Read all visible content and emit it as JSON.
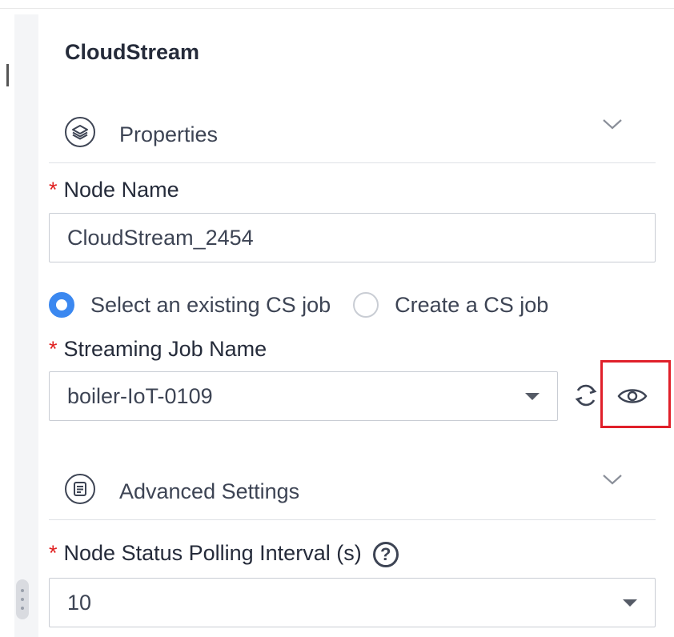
{
  "panel": {
    "title": "CloudStream"
  },
  "sections": {
    "properties": {
      "label": "Properties",
      "icon": "layers-icon"
    },
    "advanced": {
      "label": "Advanced Settings",
      "icon": "document-icon"
    }
  },
  "fields": {
    "required_mark": "*",
    "node_name": {
      "label": "Node Name",
      "value": "CloudStream_2454"
    },
    "job_source": {
      "options": [
        {
          "label": "Select an existing CS job",
          "checked": true
        },
        {
          "label": "Create a CS job",
          "checked": false
        }
      ]
    },
    "streaming_job": {
      "label": "Streaming Job Name",
      "value": "boiler-IoT-0109"
    },
    "polling_interval": {
      "label": "Node Status Polling Interval (s)",
      "value": "10",
      "help_glyph": "?"
    }
  },
  "colors": {
    "accent": "#3b88f0",
    "required": "#e02020",
    "highlight": "#e0202a"
  }
}
